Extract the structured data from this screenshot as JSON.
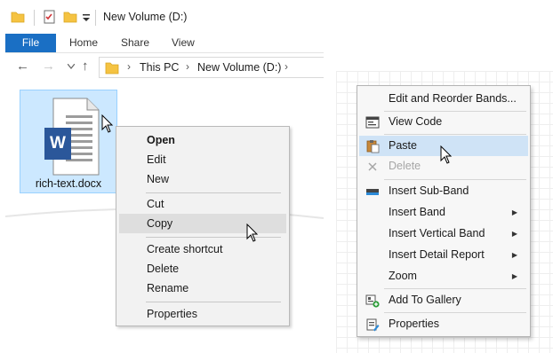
{
  "explorer": {
    "title": "New Volume (D:)",
    "tabs": {
      "file": "File",
      "home": "Home",
      "share": "Share",
      "view": "View"
    },
    "breadcrumb": [
      "This PC",
      "New Volume (D:)"
    ],
    "file": {
      "name": "rich-text.docx",
      "app_letter": "W"
    },
    "context_menu": [
      {
        "label": "Open",
        "bold": true
      },
      {
        "label": "Edit"
      },
      {
        "label": "New"
      },
      {
        "separator": true
      },
      {
        "label": "Cut"
      },
      {
        "label": "Copy",
        "highlighted": true
      },
      {
        "separator": true
      },
      {
        "label": "Create shortcut"
      },
      {
        "label": "Delete"
      },
      {
        "label": "Rename"
      },
      {
        "separator": true
      },
      {
        "label": "Properties"
      }
    ]
  },
  "designer": {
    "context_menu": [
      {
        "label": "Edit and Reorder Bands...",
        "icon": "none"
      },
      {
        "separator": true
      },
      {
        "label": "View Code",
        "icon": "view-code-icon"
      },
      {
        "separator": true
      },
      {
        "label": "Paste",
        "icon": "paste-icon",
        "highlighted": true
      },
      {
        "label": "Delete",
        "icon": "delete-icon",
        "disabled": true
      },
      {
        "separator": true
      },
      {
        "label": "Insert Sub-Band",
        "icon": "sub-band-icon"
      },
      {
        "label": "Insert Band",
        "submenu": true
      },
      {
        "label": "Insert Vertical Band",
        "submenu": true
      },
      {
        "label": "Insert Detail Report",
        "submenu": true
      },
      {
        "label": "Zoom",
        "submenu": true
      },
      {
        "separator": true
      },
      {
        "label": "Add To Gallery",
        "icon": "add-to-gallery-icon"
      },
      {
        "separator": true
      },
      {
        "label": "Properties",
        "icon": "properties-icon"
      }
    ]
  },
  "colors": {
    "file_tab": "#1a6fc4",
    "selection": "#cce8ff",
    "word_blue": "#2b579a",
    "folder": "#f5c342",
    "designer_highlight": "#cfe3f6"
  }
}
